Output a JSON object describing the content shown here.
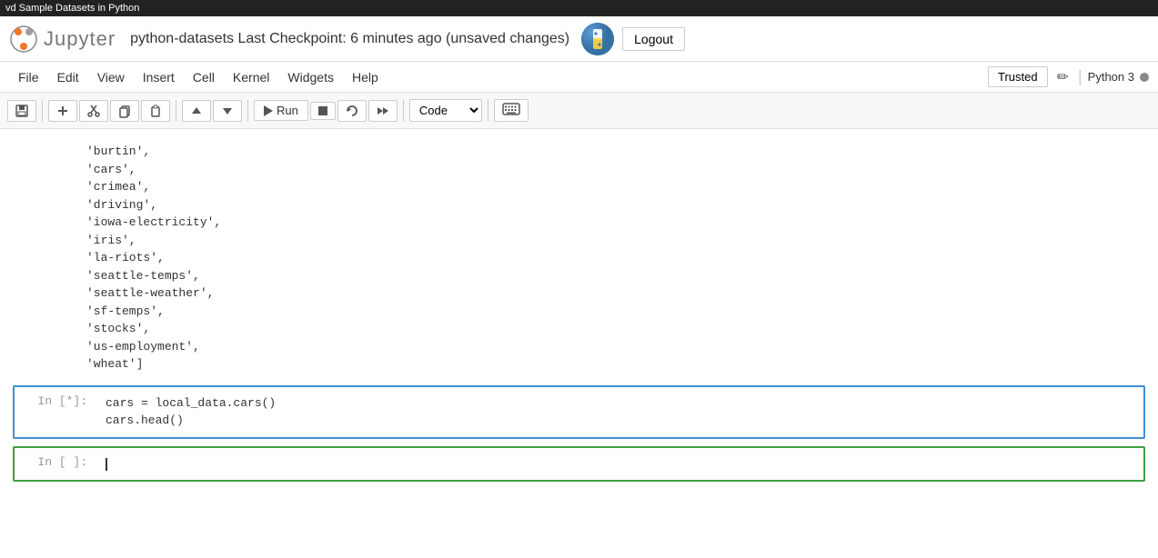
{
  "titlebar": {
    "text": "vd Sample Datasets in Python"
  },
  "header": {
    "notebook_name": "python-datasets",
    "checkpoint_text": "Last Checkpoint: 6 minutes ago  (unsaved changes)",
    "logout_label": "Logout"
  },
  "menubar": {
    "items": [
      "File",
      "Edit",
      "View",
      "Insert",
      "Cell",
      "Kernel",
      "Widgets",
      "Help"
    ],
    "trusted_label": "Trusted",
    "kernel_label": "Python 3"
  },
  "toolbar": {
    "save_title": "Save",
    "add_title": "Add cell",
    "cut_title": "Cut",
    "copy_title": "Copy",
    "paste_title": "Paste",
    "move_up_title": "Move up",
    "move_down_title": "Move down",
    "run_label": "Run",
    "stop_title": "Stop",
    "restart_title": "Restart",
    "restart_run_title": "Restart & Run",
    "cell_type": "Code",
    "keyboard_title": "Keyboard shortcuts"
  },
  "output": {
    "lines": [
      "'burtin',",
      "'cars',",
      "'crimea',",
      "'driving',",
      "'iowa-electricity',",
      "'iris',",
      "'la-riots',",
      "'seattle-temps',",
      "'seattle-weather',",
      "'sf-temps',",
      "'stocks',",
      "'us-employment',",
      "'wheat']"
    ]
  },
  "cells": [
    {
      "prompt": "In [*]:",
      "code_lines": [
        "cars = local_data.cars()",
        "cars.head()"
      ]
    },
    {
      "prompt": "In [ ]:",
      "code_lines": [
        ""
      ]
    }
  ]
}
